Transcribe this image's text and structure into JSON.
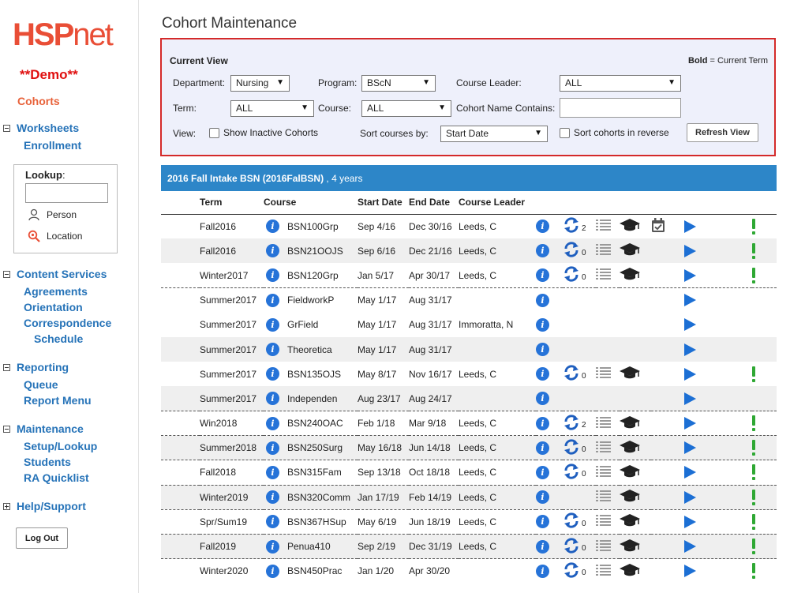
{
  "sidebar": {
    "logo_bold": "HSP",
    "logo_light": "net",
    "demo": "**Demo**",
    "cohorts": "Cohorts",
    "worksheets": "Worksheets",
    "enrollment": "Enrollment",
    "lookup_label": "Lookup",
    "lookup_colon": ":",
    "person": "Person",
    "location": "Location",
    "content_services": "Content Services",
    "agreements": "Agreements",
    "orientation": "Orientation",
    "correspondence": "Correspondence",
    "schedule": "Schedule",
    "reporting": "Reporting",
    "queue": "Queue",
    "report_menu": "Report Menu",
    "maintenance": "Maintenance",
    "setup_lookup": "Setup/Lookup",
    "students": "Students",
    "ra_quicklist": "RA Quicklist",
    "help_support": "Help/Support",
    "logout": "Log Out"
  },
  "page": {
    "title": "Cohort Maintenance"
  },
  "view": {
    "title": "Current View",
    "bold_key": "Bold",
    "bold_rest": " = Current Term",
    "department_label": "Department:",
    "department_value": "Nursing",
    "program_label": "Program:",
    "program_value": "BScN",
    "course_leader_label": "Course Leader:",
    "course_leader_value": "ALL",
    "term_label": "Term:",
    "term_value": "ALL",
    "course_label": "Course:",
    "course_value": "ALL",
    "cohort_name_label": "Cohort Name Contains:",
    "view_label": "View:",
    "show_inactive": "Show Inactive Cohorts",
    "sort_courses_label": "Sort courses by:",
    "sort_courses_value": "Start Date",
    "sort_reverse": "Sort cohorts in reverse",
    "refresh": "Refresh View"
  },
  "cohort": {
    "name": "2016 Fall Intake BSN (2016FalBSN)",
    "duration": " , 4 years",
    "columns": {
      "term": "Term",
      "course": "Course",
      "start": "Start Date",
      "end": "End Date",
      "leader": "Course Leader"
    },
    "rows": [
      {
        "term": "Fall2016",
        "course": "BSN100Grp",
        "start": "Sep 4/16",
        "end": "Dec 30/16",
        "leader": "Leeds, C",
        "sync": "2",
        "list": true,
        "grad": true,
        "cal": true,
        "bang": true,
        "dashed": false,
        "alt": false
      },
      {
        "term": "Fall2016",
        "course": "BSN21OOJS",
        "start": "Sep 6/16",
        "end": "Dec 21/16",
        "leader": "Leeds, C",
        "sync": "0",
        "list": true,
        "grad": true,
        "cal": false,
        "bang": true,
        "dashed": false,
        "alt": true
      },
      {
        "term": "Winter2017",
        "course": "BSN120Grp",
        "start": "Jan 5/17",
        "end": "Apr 30/17",
        "leader": "Leeds, C",
        "sync": "0",
        "list": true,
        "grad": true,
        "cal": false,
        "bang": true,
        "dashed": true,
        "alt": false
      },
      {
        "term": "Summer2017",
        "course": "FieldworkP",
        "start": "May 1/17",
        "end": "Aug 31/17",
        "leader": "",
        "sync": "",
        "list": false,
        "grad": false,
        "cal": false,
        "bang": false,
        "dashed": false,
        "alt": false
      },
      {
        "term": "Summer2017",
        "course": "GrField",
        "start": "May 1/17",
        "end": "Aug 31/17",
        "leader": "Immoratta, N",
        "sync": "",
        "list": false,
        "grad": false,
        "cal": false,
        "bang": false,
        "dashed": false,
        "alt": false
      },
      {
        "term": "Summer2017",
        "course": "Theoretica",
        "start": "May 1/17",
        "end": "Aug 31/17",
        "leader": "",
        "sync": "",
        "list": false,
        "grad": false,
        "cal": false,
        "bang": false,
        "dashed": false,
        "alt": true
      },
      {
        "term": "Summer2017",
        "course": "BSN135OJS",
        "start": "May 8/17",
        "end": "Nov 16/17",
        "leader": "Leeds, C",
        "sync": "0",
        "list": true,
        "grad": true,
        "cal": false,
        "bang": true,
        "dashed": false,
        "alt": false
      },
      {
        "term": "Summer2017",
        "course": "Independen",
        "start": "Aug 23/17",
        "end": "Aug 24/17",
        "leader": "",
        "sync": "",
        "list": false,
        "grad": false,
        "cal": false,
        "bang": false,
        "dashed": true,
        "alt": true
      },
      {
        "term": "Win2018",
        "course": "BSN240OAC",
        "start": "Feb 1/18",
        "end": "Mar 9/18",
        "leader": "Leeds, C",
        "sync": "2",
        "list": true,
        "grad": true,
        "cal": false,
        "bang": true,
        "dashed": true,
        "alt": false
      },
      {
        "term": "Summer2018",
        "course": "BSN250Surg",
        "start": "May 16/18",
        "end": "Jun 14/18",
        "leader": "Leeds, C",
        "sync": "0",
        "list": true,
        "grad": true,
        "cal": false,
        "bang": true,
        "dashed": true,
        "alt": true
      },
      {
        "term": "Fall2018",
        "course": "BSN315Fam",
        "start": "Sep 13/18",
        "end": "Oct 18/18",
        "leader": "Leeds, C",
        "sync": "0",
        "list": true,
        "grad": true,
        "cal": false,
        "bang": true,
        "dashed": true,
        "alt": false
      },
      {
        "term": "Winter2019",
        "course": "BSN320Comm",
        "start": "Jan 17/19",
        "end": "Feb 14/19",
        "leader": "Leeds, C",
        "sync": "",
        "list": true,
        "grad": true,
        "cal": false,
        "bang": true,
        "dashed": true,
        "alt": true
      },
      {
        "term": "Spr/Sum19",
        "course": "BSN367HSup",
        "start": "May 6/19",
        "end": "Jun 18/19",
        "leader": "Leeds, C",
        "sync": "0",
        "list": true,
        "grad": true,
        "cal": false,
        "bang": true,
        "dashed": true,
        "alt": false
      },
      {
        "term": "Fall2019",
        "course": "Penua410",
        "start": "Sep 2/19",
        "end": "Dec 31/19",
        "leader": "Leeds, C",
        "sync": "0",
        "list": true,
        "grad": true,
        "cal": false,
        "bang": true,
        "dashed": true,
        "alt": true
      },
      {
        "term": "Winter2020",
        "course": "BSN450Prac",
        "start": "Jan 1/20",
        "end": "Apr 30/20",
        "leader": "",
        "sync": "0",
        "list": true,
        "grad": true,
        "cal": false,
        "bang": true,
        "dashed": false,
        "alt": false
      }
    ]
  },
  "icons": {
    "info": "info-icon",
    "sync": "sync-icon",
    "list": "list-icon",
    "grad": "graduation-cap-icon",
    "cal": "calendar-check-icon",
    "play": "play-icon",
    "bang": "alert-icon"
  },
  "colors": {
    "brand": "#e94e36",
    "link": "#2673b8",
    "header": "#2d86c8",
    "highlight_border": "#d42a2a",
    "alert": "#2fa834"
  }
}
